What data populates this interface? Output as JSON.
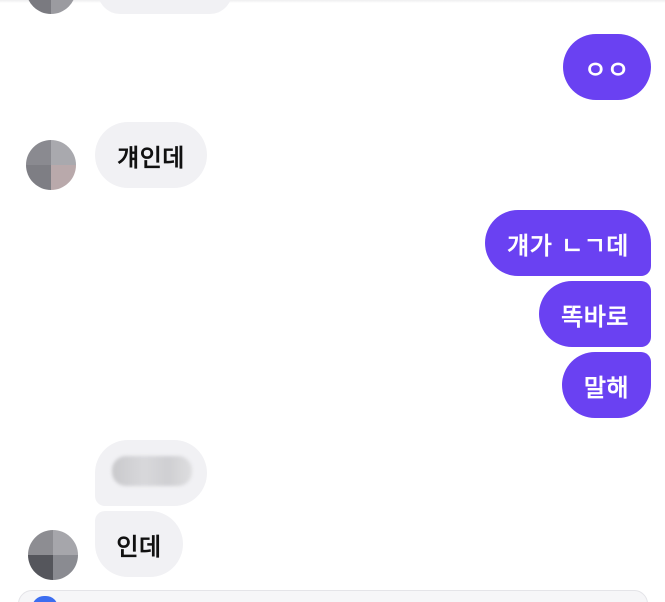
{
  "chat": {
    "messages": [
      {
        "id": "m1",
        "side": "outgoing",
        "text": "ㅇㅇ"
      },
      {
        "id": "m2",
        "side": "incoming",
        "text": "걔인데"
      },
      {
        "id": "m3",
        "side": "outgoing",
        "text": "걔가 ㄴㄱ데"
      },
      {
        "id": "m4",
        "side": "outgoing",
        "text": "똑바로"
      },
      {
        "id": "m5",
        "side": "outgoing",
        "text": "말해"
      },
      {
        "id": "m6",
        "side": "incoming",
        "text": "",
        "redacted": true
      },
      {
        "id": "m7",
        "side": "incoming",
        "text": "인데"
      }
    ]
  },
  "colors": {
    "outgoing_bubble": "#6a41f2",
    "incoming_bubble": "#f1f1f4",
    "composer_accent": "#3c6df0"
  }
}
